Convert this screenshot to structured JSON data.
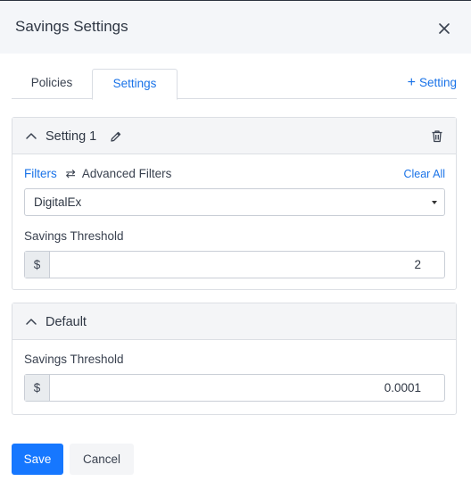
{
  "dialog": {
    "title": "Savings Settings",
    "close_icon": "close-icon"
  },
  "tabs": [
    {
      "label": "Policies",
      "active": false
    },
    {
      "label": "Settings",
      "active": true
    }
  ],
  "add_setting": {
    "icon": "+",
    "label": "Setting"
  },
  "setting1": {
    "title": "Setting 1",
    "filters_label": "Filters",
    "swap_glyph": "⇄",
    "advanced_filters_label": "Advanced Filters",
    "clear_all_label": "Clear All",
    "filter_value": "DigitalEx",
    "threshold_label": "Savings Threshold",
    "currency": "$",
    "threshold_value": "2"
  },
  "default_setting": {
    "title": "Default",
    "threshold_label": "Savings Threshold",
    "currency": "$",
    "threshold_value": "0.0001"
  },
  "footer": {
    "save_label": "Save",
    "cancel_label": "Cancel"
  },
  "colors": {
    "accent": "#1a73e8",
    "primary_button": "#1677ff"
  }
}
